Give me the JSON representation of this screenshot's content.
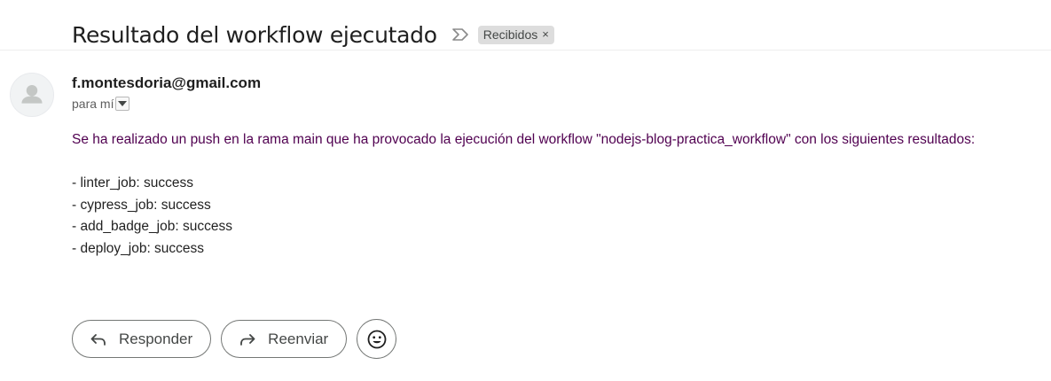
{
  "email": {
    "subject": "Resultado del workflow ejecutado",
    "label": {
      "text": "Recibidos",
      "close_glyph": "×"
    },
    "sender": "f.montesdoria@gmail.com",
    "recipient": "para mí",
    "body": {
      "intro": "Se ha realizado un push en la rama main que ha provocado la ejecución del workflow \"nodejs-blog-practica_workflow\" con los siguientes resultados:",
      "jobs": [
        "- linter_job: success",
        "- cypress_job: success",
        "- add_badge_job: success",
        "- deploy_job: success"
      ]
    }
  },
  "actions": {
    "reply_label": "Responder",
    "forward_label": "Reenviar"
  },
  "icons": {
    "important": "important-marker-icon",
    "avatar": "default-avatar-icon",
    "dropdown": "caret-down-icon",
    "reply": "reply-arrow-icon",
    "forward": "forward-arrow-icon",
    "emoji": "smiley-face-icon"
  },
  "colors": {
    "intro_text": "#500050",
    "body_text": "#222222",
    "label_chip_bg": "#dddddd"
  }
}
